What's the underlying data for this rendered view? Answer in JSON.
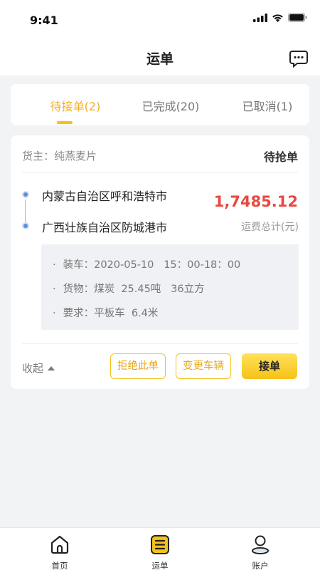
{
  "status_bar": {
    "time": "9:41"
  },
  "header": {
    "title": "运单",
    "message_icon": "message-icon"
  },
  "tabs": [
    {
      "label": "待接单(2)",
      "active": true
    },
    {
      "label": "已完成(20)",
      "active": false
    },
    {
      "label": "已取消(1)",
      "active": false
    }
  ],
  "order": {
    "shipper_label": "货主：",
    "shipper_name": "纯燕麦片",
    "status": "待抢单",
    "from": "内蒙古自治区呼和浩特市",
    "to": "广西壮族自治区防城港市",
    "price": "1,7485.12",
    "price_label": "运费总计(元)",
    "details": [
      {
        "bullet": "·",
        "text": "装车：2020-05-10   15：00-18：00"
      },
      {
        "bullet": "·",
        "text": "货物：煤炭  25.45吨   36立方"
      },
      {
        "bullet": "·",
        "text": "要求：平板车  6.4米"
      }
    ],
    "collapse_label": "收起",
    "reject_label": "拒绝此单",
    "change_vehicle_label": "变更车辆",
    "accept_label": "接单"
  },
  "tab_bar": [
    {
      "label": "首页",
      "icon": "home-icon",
      "active": false
    },
    {
      "label": "运单",
      "icon": "waybill-icon",
      "active": true
    },
    {
      "label": "账户",
      "icon": "account-icon",
      "active": false
    }
  ],
  "colors": {
    "accent": "#f5c11b",
    "price": "#e8483f",
    "route": "#5b8fd9"
  }
}
